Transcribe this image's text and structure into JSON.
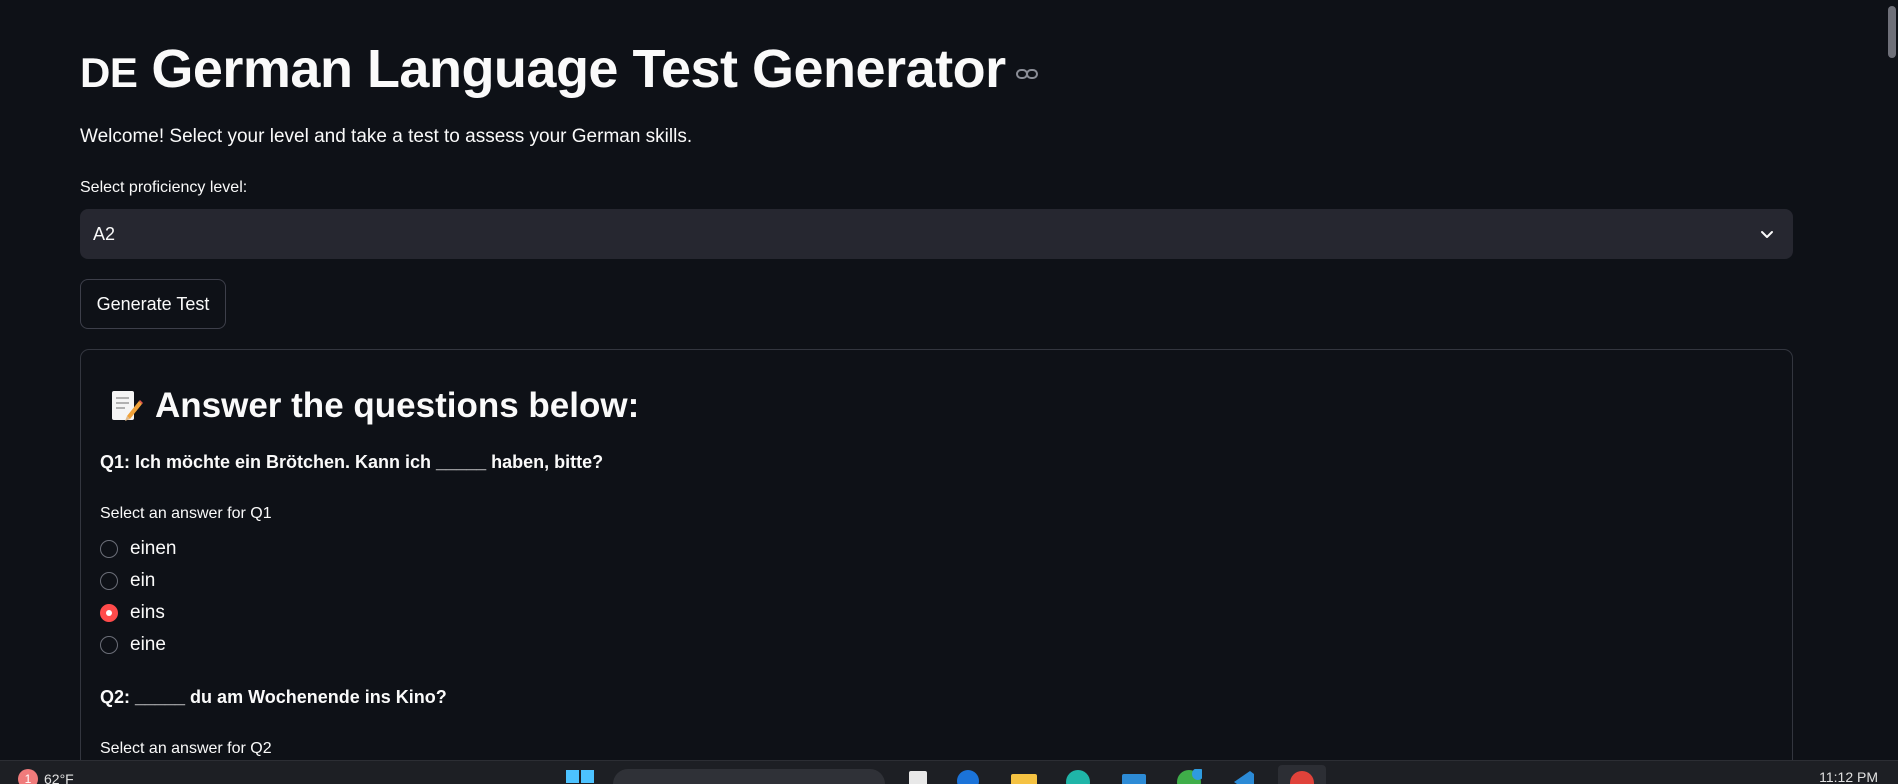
{
  "header": {
    "flag_text": "DE",
    "title": "German Language Test Generator"
  },
  "welcome_text": "Welcome! Select your level and take a test to assess your German skills.",
  "level_select": {
    "label": "Select proficiency level:",
    "value": "A2"
  },
  "generate_button_label": "Generate Test",
  "test_card": {
    "title": "Answer the questions below:",
    "questions": [
      {
        "text": "Q1: Ich möchte ein Brötchen. Kann ich _____ haben, bitte?",
        "prompt": "Select an answer for Q1",
        "options": [
          "einen",
          "ein",
          "eins",
          "eine"
        ],
        "selected": "eins"
      },
      {
        "text": "Q2: _____ du am Wochenende ins Kino?",
        "prompt": "Select an answer for Q2"
      }
    ]
  },
  "taskbar": {
    "weather_badge": "1",
    "weather_temp": "62°F",
    "clock": "11:12 PM"
  },
  "colors": {
    "background": "#0e1117",
    "widget_bg": "#262730",
    "accent": "#ff4b4b"
  }
}
